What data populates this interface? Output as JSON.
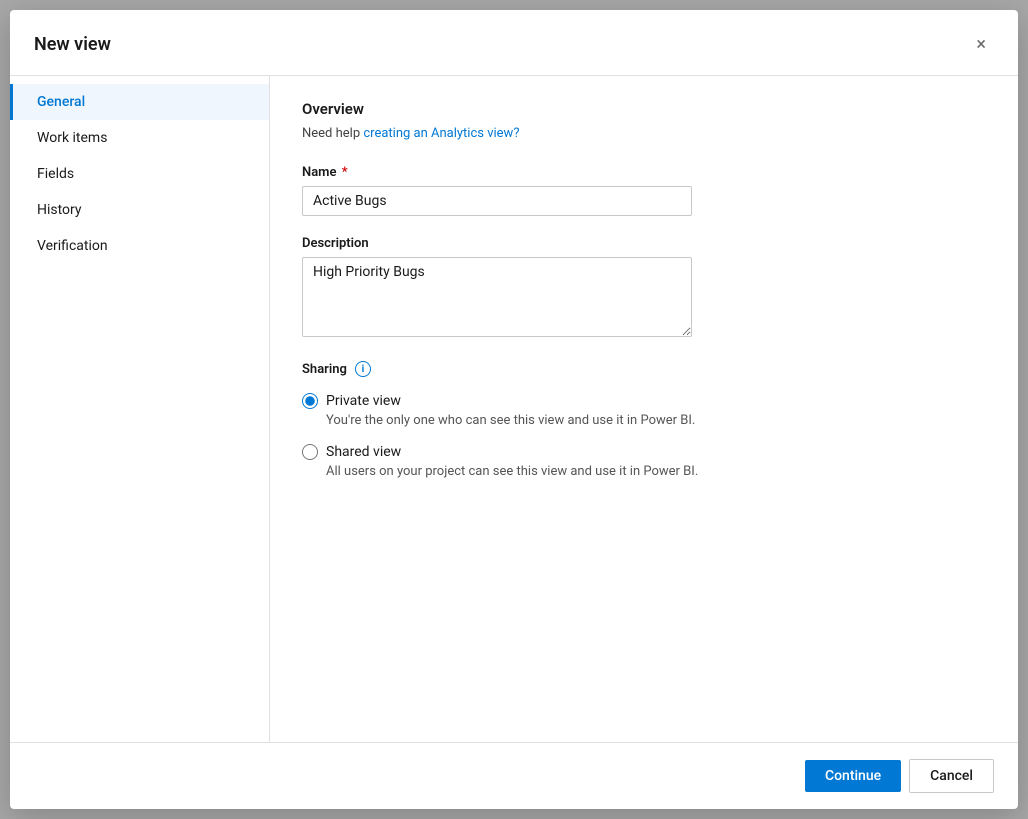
{
  "dialog": {
    "title": "New view",
    "close_icon": "×"
  },
  "sidebar": {
    "items": [
      {
        "label": "General",
        "active": true
      },
      {
        "label": "Work items",
        "active": false
      },
      {
        "label": "Fields",
        "active": false
      },
      {
        "label": "History",
        "active": false
      },
      {
        "label": "Verification",
        "active": false
      }
    ]
  },
  "main": {
    "section_title": "Overview",
    "help_text_prefix": "Need help ",
    "help_link_label": "creating an Analytics view?",
    "help_link_href": "#",
    "name_label": "Name",
    "name_required": true,
    "name_value": "Active Bugs",
    "name_placeholder": "",
    "description_label": "Description",
    "description_value": "High Priority Bugs",
    "description_placeholder": "",
    "sharing_label": "Sharing",
    "info_icon_label": "i",
    "radio_options": [
      {
        "id": "private",
        "label": "Private view",
        "description": "You're the only one who can see this view and use it in Power BI.",
        "checked": true
      },
      {
        "id": "shared",
        "label": "Shared view",
        "description": "All users on your project can see this view and use it in Power BI.",
        "checked": false
      }
    ]
  },
  "footer": {
    "continue_label": "Continue",
    "cancel_label": "Cancel"
  }
}
